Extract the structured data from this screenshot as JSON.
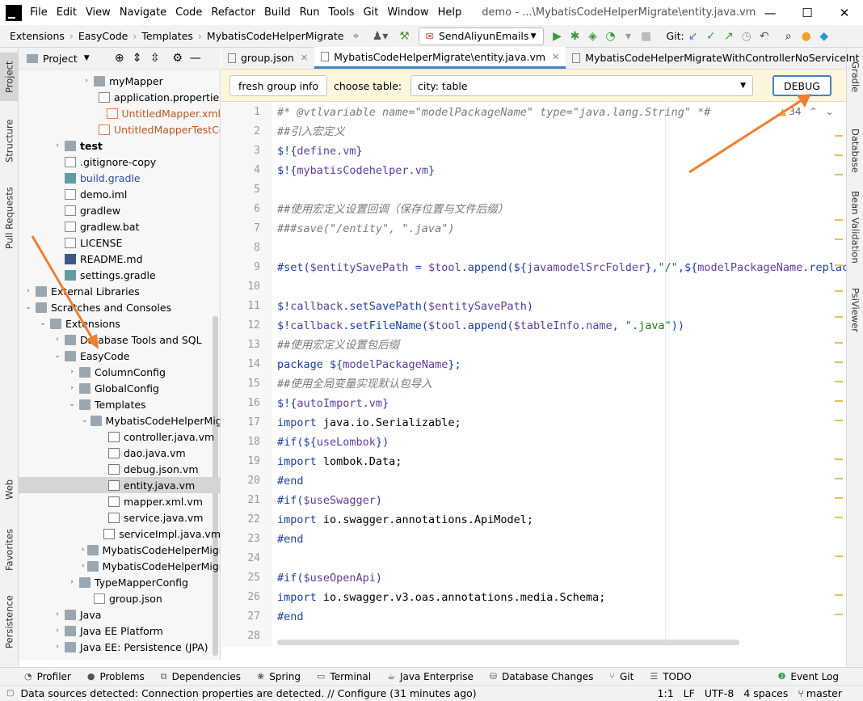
{
  "window": {
    "menu": [
      "File",
      "Edit",
      "View",
      "Navigate",
      "Code",
      "Refactor",
      "Build",
      "Run",
      "Tools",
      "Git",
      "Window",
      "Help"
    ],
    "title": "demo - ...\\MybatisCodeHelperMigrate\\entity.java.vm",
    "minimize": "—",
    "maximize": "☐",
    "close": "✕"
  },
  "navbar": {
    "breadcrumbs": [
      "Extensions",
      "EasyCode",
      "Templates",
      "MybatisCodeHelperMigrate"
    ],
    "run_config": "SendAliyunEmails",
    "git_label": "Git:"
  },
  "left_strip": {
    "tabs": [
      "Project",
      "Structure",
      "Pull Requests",
      "Web",
      "Favorites",
      "Persistence"
    ]
  },
  "right_strip": {
    "tabs": [
      "Gradle",
      "Database",
      "Bean Validation",
      "PsiViewer"
    ]
  },
  "project": {
    "header": "Project",
    "tree": [
      {
        "label": "myMapper",
        "type": "folder",
        "depth": 4,
        "arrow": "›",
        "color": ""
      },
      {
        "label": "application.properties",
        "type": "file",
        "depth": 5,
        "arrow": "",
        "color": ""
      },
      {
        "label": "UntitledMapper.xml",
        "type": "xml",
        "depth": 5,
        "arrow": "",
        "color": "red"
      },
      {
        "label": "UntitledMapperTestController.java",
        "type": "xml",
        "depth": 5,
        "arrow": "",
        "color": "red"
      },
      {
        "label": "test",
        "type": "folder",
        "depth": 2,
        "arrow": "›",
        "color": "bold"
      },
      {
        "label": ".gitignore-copy",
        "type": "file",
        "depth": 2,
        "arrow": "",
        "color": ""
      },
      {
        "label": "build.gradle",
        "type": "gr",
        "depth": 2,
        "arrow": "",
        "color": "blue"
      },
      {
        "label": "demo.iml",
        "type": "file",
        "depth": 2,
        "arrow": "",
        "color": ""
      },
      {
        "label": "gradlew",
        "type": "file",
        "depth": 2,
        "arrow": "",
        "color": ""
      },
      {
        "label": "gradlew.bat",
        "type": "file",
        "depth": 2,
        "arrow": "",
        "color": ""
      },
      {
        "label": "LICENSE",
        "type": "file",
        "depth": 2,
        "arrow": "",
        "color": ""
      },
      {
        "label": "README.md",
        "type": "md",
        "depth": 2,
        "arrow": "",
        "color": ""
      },
      {
        "label": "settings.gradle",
        "type": "gr",
        "depth": 2,
        "arrow": "",
        "color": ""
      },
      {
        "label": "External Libraries",
        "type": "folder",
        "depth": 0,
        "arrow": "›",
        "color": ""
      },
      {
        "label": "Scratches and Consoles",
        "type": "folder",
        "depth": 0,
        "arrow": "⌄",
        "color": ""
      },
      {
        "label": "Extensions",
        "type": "folder",
        "depth": 1,
        "arrow": "⌄",
        "color": ""
      },
      {
        "label": "Database Tools and SQL",
        "type": "folder",
        "depth": 2,
        "arrow": "›",
        "color": ""
      },
      {
        "label": "EasyCode",
        "type": "folder",
        "depth": 2,
        "arrow": "⌄",
        "color": ""
      },
      {
        "label": "ColumnConfig",
        "type": "folder",
        "depth": 3,
        "arrow": "›",
        "color": ""
      },
      {
        "label": "GlobalConfig",
        "type": "folder",
        "depth": 3,
        "arrow": "›",
        "color": ""
      },
      {
        "label": "Templates",
        "type": "folder",
        "depth": 3,
        "arrow": "⌄",
        "color": ""
      },
      {
        "label": "MybatisCodeHelperMigrate",
        "type": "folder",
        "depth": 4,
        "arrow": "⌄",
        "color": ""
      },
      {
        "label": "controller.java.vm",
        "type": "vm",
        "depth": 5,
        "arrow": "",
        "color": ""
      },
      {
        "label": "dao.java.vm",
        "type": "vm",
        "depth": 5,
        "arrow": "",
        "color": ""
      },
      {
        "label": "debug.json.vm",
        "type": "vm",
        "depth": 5,
        "arrow": "",
        "color": ""
      },
      {
        "label": "entity.java.vm",
        "type": "vm",
        "depth": 5,
        "arrow": "",
        "color": "",
        "selected": true
      },
      {
        "label": "mapper.xml.vm",
        "type": "vm",
        "depth": 5,
        "arrow": "",
        "color": ""
      },
      {
        "label": "service.java.vm",
        "type": "vm",
        "depth": 5,
        "arrow": "",
        "color": ""
      },
      {
        "label": "serviceImpl.java.vm",
        "type": "vm",
        "depth": 5,
        "arrow": "",
        "color": ""
      },
      {
        "label": "MybatisCodeHelperMigrateWithController",
        "type": "folder",
        "depth": 4,
        "arrow": "›",
        "color": ""
      },
      {
        "label": "MybatisCodeHelperMigrateWithControllerNoService",
        "type": "folder",
        "depth": 4,
        "arrow": "›",
        "color": ""
      },
      {
        "label": "TypeMapperConfig",
        "type": "folder",
        "depth": 3,
        "arrow": "›",
        "color": ""
      },
      {
        "label": "group.json",
        "type": "file",
        "depth": 4,
        "arrow": "",
        "color": ""
      },
      {
        "label": "Java",
        "type": "folder",
        "depth": 2,
        "arrow": "›",
        "color": ""
      },
      {
        "label": "Java EE Platform",
        "type": "folder",
        "depth": 2,
        "arrow": "›",
        "color": ""
      },
      {
        "label": "Java EE: Persistence (JPA)",
        "type": "folder",
        "depth": 2,
        "arrow": "›",
        "color": ""
      }
    ]
  },
  "tabs": [
    {
      "label": "group.json",
      "active": false
    },
    {
      "label": "MybatisCodeHelperMigrate\\entity.java.vm",
      "active": true
    },
    {
      "label": "MybatisCodeHelperMigrateWithControllerNoServiceInt",
      "active": false
    }
  ],
  "easycode": {
    "refresh_label": "fresh group info",
    "choose_table_label": "choose table:",
    "table_value": "city: table",
    "debug_label": "DEBUG"
  },
  "editor": {
    "warning_count": "34",
    "lines": [
      [
        [
          "cm",
          "#* @vtlvariable name=\"modelPackageName\" type=\"java.lang.String\" *#"
        ]
      ],
      [
        [
          "cm",
          "##引入宏定义"
        ]
      ],
      [
        [
          "kw",
          "$!{"
        ],
        [
          "vr",
          "define.vm"
        ],
        [
          "kw",
          "}"
        ]
      ],
      [
        [
          "kw",
          "$!{"
        ],
        [
          "vr",
          "mybatisCodehelper.vm"
        ],
        [
          "kw",
          "}"
        ]
      ],
      [],
      [
        [
          "cm",
          "##使用宏定义设置回调（保存位置与文件后缀）"
        ]
      ],
      [
        [
          "cm",
          "###save(\"/entity\", \".java\")"
        ]
      ],
      [],
      [
        [
          "kw",
          "#set("
        ],
        [
          "vr",
          "$entitySavePath"
        ],
        [
          "kw",
          " = "
        ],
        [
          "vr",
          "$tool"
        ],
        [
          "kw",
          ".append(${"
        ],
        [
          "vr",
          "javamodelSrcFolder"
        ],
        [
          "kw",
          "},"
        ],
        [
          "st",
          "\"/\""
        ],
        [
          "kw",
          ",${"
        ],
        [
          "vr",
          "modelPackageName"
        ],
        [
          "kw",
          ".replace"
        ]
      ],
      [],
      [
        [
          "kw",
          "$!"
        ],
        [
          "vr",
          "callback"
        ],
        [
          "kw",
          ".setSavePath("
        ],
        [
          "vr",
          "$entitySavePath"
        ],
        [
          "kw",
          ")"
        ]
      ],
      [
        [
          "kw",
          "$!"
        ],
        [
          "vr",
          "callback"
        ],
        [
          "kw",
          ".setFileName("
        ],
        [
          "vr",
          "$tool"
        ],
        [
          "kw",
          ".append("
        ],
        [
          "vr",
          "$tableInfo"
        ],
        [
          "kw",
          "."
        ],
        [
          "vr",
          "name"
        ],
        [
          "kw",
          ", "
        ],
        [
          "st",
          "\".java\""
        ],
        [
          "kw",
          "))"
        ]
      ],
      [
        [
          "cm",
          "##使用宏定义设置包后缀"
        ]
      ],
      [
        [
          "kw",
          "package ${"
        ],
        [
          "vr",
          "modelPackageName"
        ],
        [
          "kw",
          "};"
        ]
      ],
      [
        [
          "cm",
          "##使用全局变量实现默认包导入"
        ]
      ],
      [
        [
          "kw",
          "$!{"
        ],
        [
          "vr",
          "autoImport.vm"
        ],
        [
          "kw",
          "}"
        ]
      ],
      [
        [
          "kw",
          "import "
        ],
        [
          "",
          "java.io.Serializable;"
        ]
      ],
      [
        [
          "kw",
          "#if(${"
        ],
        [
          "vr",
          "useLombok"
        ],
        [
          "kw",
          "})"
        ]
      ],
      [
        [
          "kw",
          "import "
        ],
        [
          "",
          "lombok.Data;"
        ]
      ],
      [
        [
          "kw",
          "#end"
        ]
      ],
      [
        [
          "kw",
          "#if("
        ],
        [
          "vr",
          "$useSwagger"
        ],
        [
          "kw",
          ")"
        ]
      ],
      [
        [
          "kw",
          "import "
        ],
        [
          "",
          "io.swagger.annotations.ApiModel;"
        ]
      ],
      [
        [
          "kw",
          "#end"
        ]
      ],
      [],
      [
        [
          "kw",
          "#if("
        ],
        [
          "vr",
          "$useOpenApi"
        ],
        [
          "kw",
          ")"
        ]
      ],
      [
        [
          "kw",
          "import "
        ],
        [
          "",
          "io.swagger.v3.oas.annotations.media.Schema;"
        ]
      ],
      [
        [
          "kw",
          "#end"
        ]
      ],
      []
    ]
  },
  "bottom_tools": [
    "Profiler",
    "Problems",
    "Dependencies",
    "Spring",
    "Terminal",
    "Java Enterprise",
    "Database Changes",
    "Git",
    "TODO"
  ],
  "event_log": "Event Log",
  "status": {
    "message": "Data sources detected: Connection properties are detected. // Configure (31 minutes ago)",
    "position": "1:1",
    "line_sep": "LF",
    "encoding": "UTF-8",
    "indent": "4 spaces",
    "branch": "master"
  },
  "colors": {
    "accent": "#4083c9",
    "annotation_arrow": "#f08030",
    "selection": "#d5d5d5"
  }
}
